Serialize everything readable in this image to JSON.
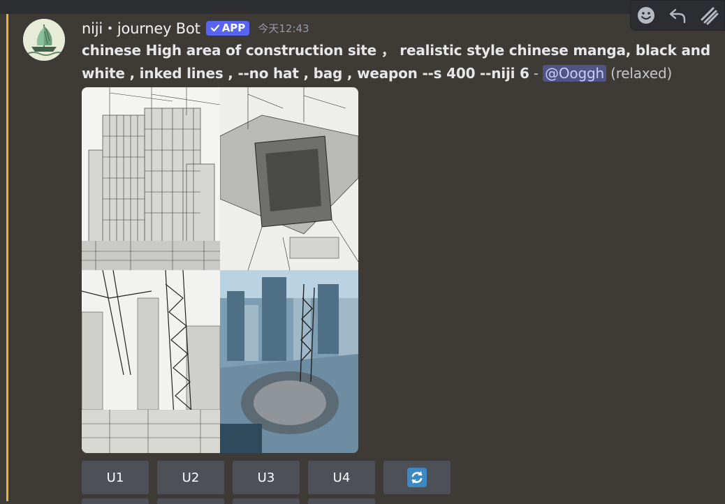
{
  "message": {
    "username": "niji・journey Bot",
    "badge": "APP",
    "timestamp": "今天12:43",
    "prompt_line": "chinese High area of construction site ， realistic style chinese manga, black and white , inked lines , --no hat , bag , weapon --s 400 --niji 6",
    "separator": " - ",
    "mention": "@Ooggh",
    "mode": "(relaxed)"
  },
  "buttons": [
    {
      "label": "U1"
    },
    {
      "label": "U2"
    },
    {
      "label": "U3"
    },
    {
      "label": "U4"
    }
  ],
  "icons": {
    "reroll": "reroll-icon",
    "toolbar": [
      "emoji-reaction-icon",
      "reply-icon",
      "more-actions-icon"
    ]
  },
  "colors": {
    "accent_line": "#f0b232",
    "badge": "#5865f2",
    "mention_bg": "#525386",
    "button_bg": "#4e5058",
    "reroll_icon": "#3b88c3"
  }
}
